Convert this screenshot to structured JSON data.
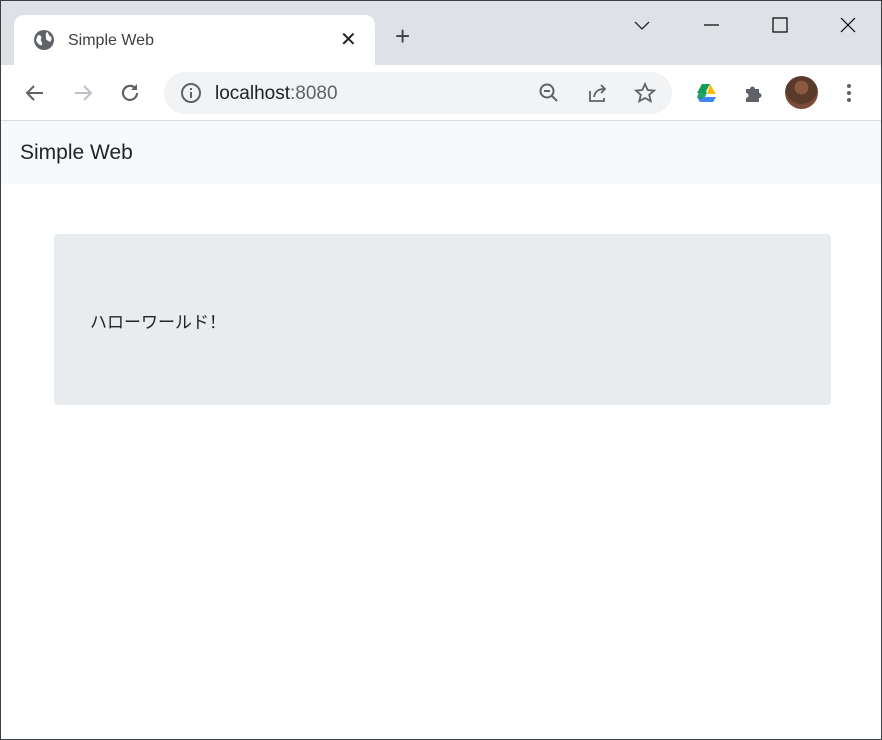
{
  "browser": {
    "tab": {
      "title": "Simple Web",
      "icon": "globe-icon"
    },
    "new_tab_label": "+",
    "address": {
      "host": "localhost",
      "port": ":8080"
    },
    "colors": {
      "tabstrip": "#dee1e6",
      "toolbar": "#ffffff",
      "omnibox": "#f1f3f4"
    }
  },
  "page": {
    "navbar": {
      "brand": "Simple Web"
    },
    "card": {
      "message": "ハローワールド！"
    },
    "colors": {
      "navbar": "#f8f9fa",
      "card": "#e9ecef",
      "text": "#212529"
    }
  }
}
